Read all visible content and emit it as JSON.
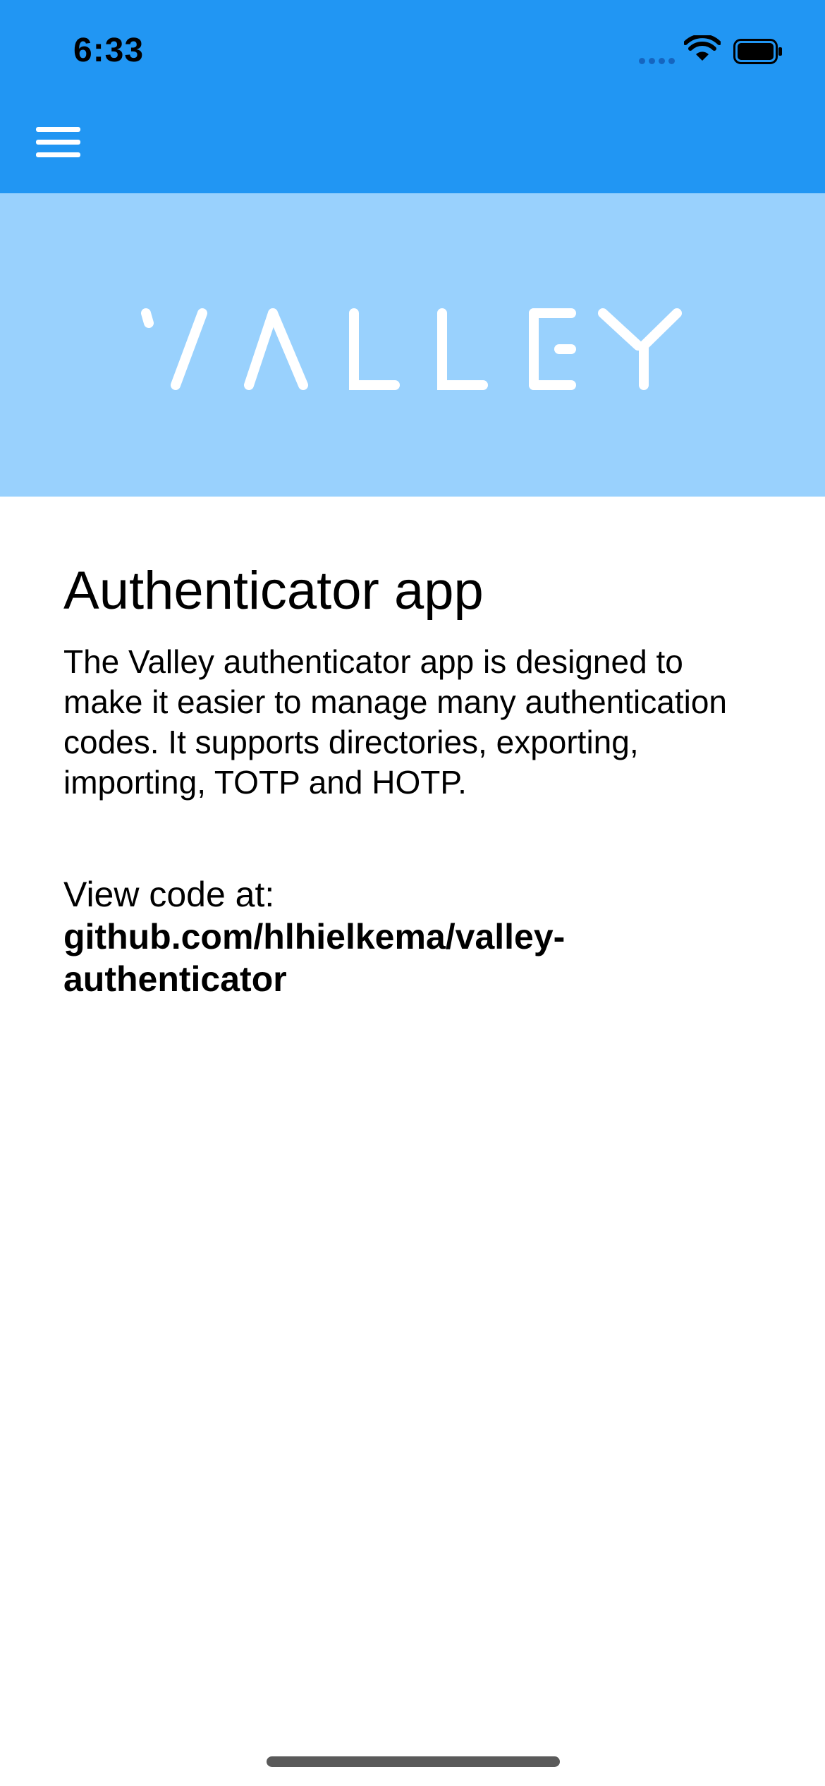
{
  "status_bar": {
    "time": "6:33"
  },
  "toolbar": {
    "menu_icon": "menu-icon",
    "background_color": "#2196f3"
  },
  "banner": {
    "logo_text": "VALLEY",
    "background_color": "#99d1fd"
  },
  "about": {
    "title": "Authenticator app",
    "description": "The Valley authenticator app is designed to make it easier to manage many authentication codes. It supports directories, exporting, importing, TOTP and HOTP.",
    "view_code_label": "View code at: ",
    "repo_link": "github.com/hlhielkema/valley-authenticator"
  }
}
